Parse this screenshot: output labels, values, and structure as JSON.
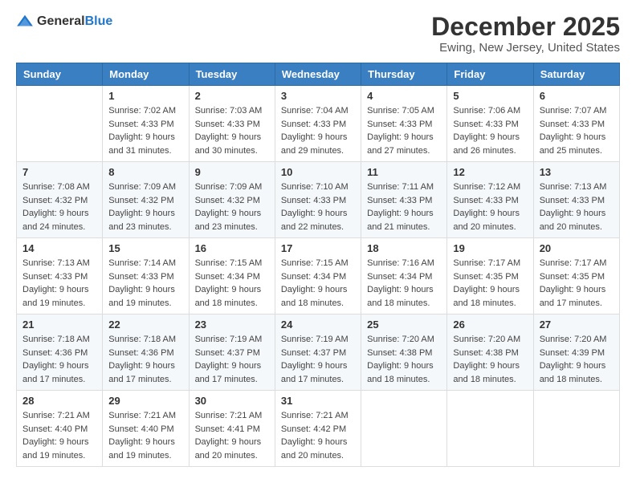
{
  "logo": {
    "text_general": "General",
    "text_blue": "Blue"
  },
  "header": {
    "title": "December 2025",
    "subtitle": "Ewing, New Jersey, United States"
  },
  "columns": [
    "Sunday",
    "Monday",
    "Tuesday",
    "Wednesday",
    "Thursday",
    "Friday",
    "Saturday"
  ],
  "weeks": [
    [
      {
        "day": "",
        "sunrise": "",
        "sunset": "",
        "daylight": ""
      },
      {
        "day": "1",
        "sunrise": "Sunrise: 7:02 AM",
        "sunset": "Sunset: 4:33 PM",
        "daylight": "Daylight: 9 hours and 31 minutes."
      },
      {
        "day": "2",
        "sunrise": "Sunrise: 7:03 AM",
        "sunset": "Sunset: 4:33 PM",
        "daylight": "Daylight: 9 hours and 30 minutes."
      },
      {
        "day": "3",
        "sunrise": "Sunrise: 7:04 AM",
        "sunset": "Sunset: 4:33 PM",
        "daylight": "Daylight: 9 hours and 29 minutes."
      },
      {
        "day": "4",
        "sunrise": "Sunrise: 7:05 AM",
        "sunset": "Sunset: 4:33 PM",
        "daylight": "Daylight: 9 hours and 27 minutes."
      },
      {
        "day": "5",
        "sunrise": "Sunrise: 7:06 AM",
        "sunset": "Sunset: 4:33 PM",
        "daylight": "Daylight: 9 hours and 26 minutes."
      },
      {
        "day": "6",
        "sunrise": "Sunrise: 7:07 AM",
        "sunset": "Sunset: 4:33 PM",
        "daylight": "Daylight: 9 hours and 25 minutes."
      }
    ],
    [
      {
        "day": "7",
        "sunrise": "Sunrise: 7:08 AM",
        "sunset": "Sunset: 4:32 PM",
        "daylight": "Daylight: 9 hours and 24 minutes."
      },
      {
        "day": "8",
        "sunrise": "Sunrise: 7:09 AM",
        "sunset": "Sunset: 4:32 PM",
        "daylight": "Daylight: 9 hours and 23 minutes."
      },
      {
        "day": "9",
        "sunrise": "Sunrise: 7:09 AM",
        "sunset": "Sunset: 4:32 PM",
        "daylight": "Daylight: 9 hours and 23 minutes."
      },
      {
        "day": "10",
        "sunrise": "Sunrise: 7:10 AM",
        "sunset": "Sunset: 4:33 PM",
        "daylight": "Daylight: 9 hours and 22 minutes."
      },
      {
        "day": "11",
        "sunrise": "Sunrise: 7:11 AM",
        "sunset": "Sunset: 4:33 PM",
        "daylight": "Daylight: 9 hours and 21 minutes."
      },
      {
        "day": "12",
        "sunrise": "Sunrise: 7:12 AM",
        "sunset": "Sunset: 4:33 PM",
        "daylight": "Daylight: 9 hours and 20 minutes."
      },
      {
        "day": "13",
        "sunrise": "Sunrise: 7:13 AM",
        "sunset": "Sunset: 4:33 PM",
        "daylight": "Daylight: 9 hours and 20 minutes."
      }
    ],
    [
      {
        "day": "14",
        "sunrise": "Sunrise: 7:13 AM",
        "sunset": "Sunset: 4:33 PM",
        "daylight": "Daylight: 9 hours and 19 minutes."
      },
      {
        "day": "15",
        "sunrise": "Sunrise: 7:14 AM",
        "sunset": "Sunset: 4:33 PM",
        "daylight": "Daylight: 9 hours and 19 minutes."
      },
      {
        "day": "16",
        "sunrise": "Sunrise: 7:15 AM",
        "sunset": "Sunset: 4:34 PM",
        "daylight": "Daylight: 9 hours and 18 minutes."
      },
      {
        "day": "17",
        "sunrise": "Sunrise: 7:15 AM",
        "sunset": "Sunset: 4:34 PM",
        "daylight": "Daylight: 9 hours and 18 minutes."
      },
      {
        "day": "18",
        "sunrise": "Sunrise: 7:16 AM",
        "sunset": "Sunset: 4:34 PM",
        "daylight": "Daylight: 9 hours and 18 minutes."
      },
      {
        "day": "19",
        "sunrise": "Sunrise: 7:17 AM",
        "sunset": "Sunset: 4:35 PM",
        "daylight": "Daylight: 9 hours and 18 minutes."
      },
      {
        "day": "20",
        "sunrise": "Sunrise: 7:17 AM",
        "sunset": "Sunset: 4:35 PM",
        "daylight": "Daylight: 9 hours and 17 minutes."
      }
    ],
    [
      {
        "day": "21",
        "sunrise": "Sunrise: 7:18 AM",
        "sunset": "Sunset: 4:36 PM",
        "daylight": "Daylight: 9 hours and 17 minutes."
      },
      {
        "day": "22",
        "sunrise": "Sunrise: 7:18 AM",
        "sunset": "Sunset: 4:36 PM",
        "daylight": "Daylight: 9 hours and 17 minutes."
      },
      {
        "day": "23",
        "sunrise": "Sunrise: 7:19 AM",
        "sunset": "Sunset: 4:37 PM",
        "daylight": "Daylight: 9 hours and 17 minutes."
      },
      {
        "day": "24",
        "sunrise": "Sunrise: 7:19 AM",
        "sunset": "Sunset: 4:37 PM",
        "daylight": "Daylight: 9 hours and 17 minutes."
      },
      {
        "day": "25",
        "sunrise": "Sunrise: 7:20 AM",
        "sunset": "Sunset: 4:38 PM",
        "daylight": "Daylight: 9 hours and 18 minutes."
      },
      {
        "day": "26",
        "sunrise": "Sunrise: 7:20 AM",
        "sunset": "Sunset: 4:38 PM",
        "daylight": "Daylight: 9 hours and 18 minutes."
      },
      {
        "day": "27",
        "sunrise": "Sunrise: 7:20 AM",
        "sunset": "Sunset: 4:39 PM",
        "daylight": "Daylight: 9 hours and 18 minutes."
      }
    ],
    [
      {
        "day": "28",
        "sunrise": "Sunrise: 7:21 AM",
        "sunset": "Sunset: 4:40 PM",
        "daylight": "Daylight: 9 hours and 19 minutes."
      },
      {
        "day": "29",
        "sunrise": "Sunrise: 7:21 AM",
        "sunset": "Sunset: 4:40 PM",
        "daylight": "Daylight: 9 hours and 19 minutes."
      },
      {
        "day": "30",
        "sunrise": "Sunrise: 7:21 AM",
        "sunset": "Sunset: 4:41 PM",
        "daylight": "Daylight: 9 hours and 20 minutes."
      },
      {
        "day": "31",
        "sunrise": "Sunrise: 7:21 AM",
        "sunset": "Sunset: 4:42 PM",
        "daylight": "Daylight: 9 hours and 20 minutes."
      },
      {
        "day": "",
        "sunrise": "",
        "sunset": "",
        "daylight": ""
      },
      {
        "day": "",
        "sunrise": "",
        "sunset": "",
        "daylight": ""
      },
      {
        "day": "",
        "sunrise": "",
        "sunset": "",
        "daylight": ""
      }
    ]
  ]
}
